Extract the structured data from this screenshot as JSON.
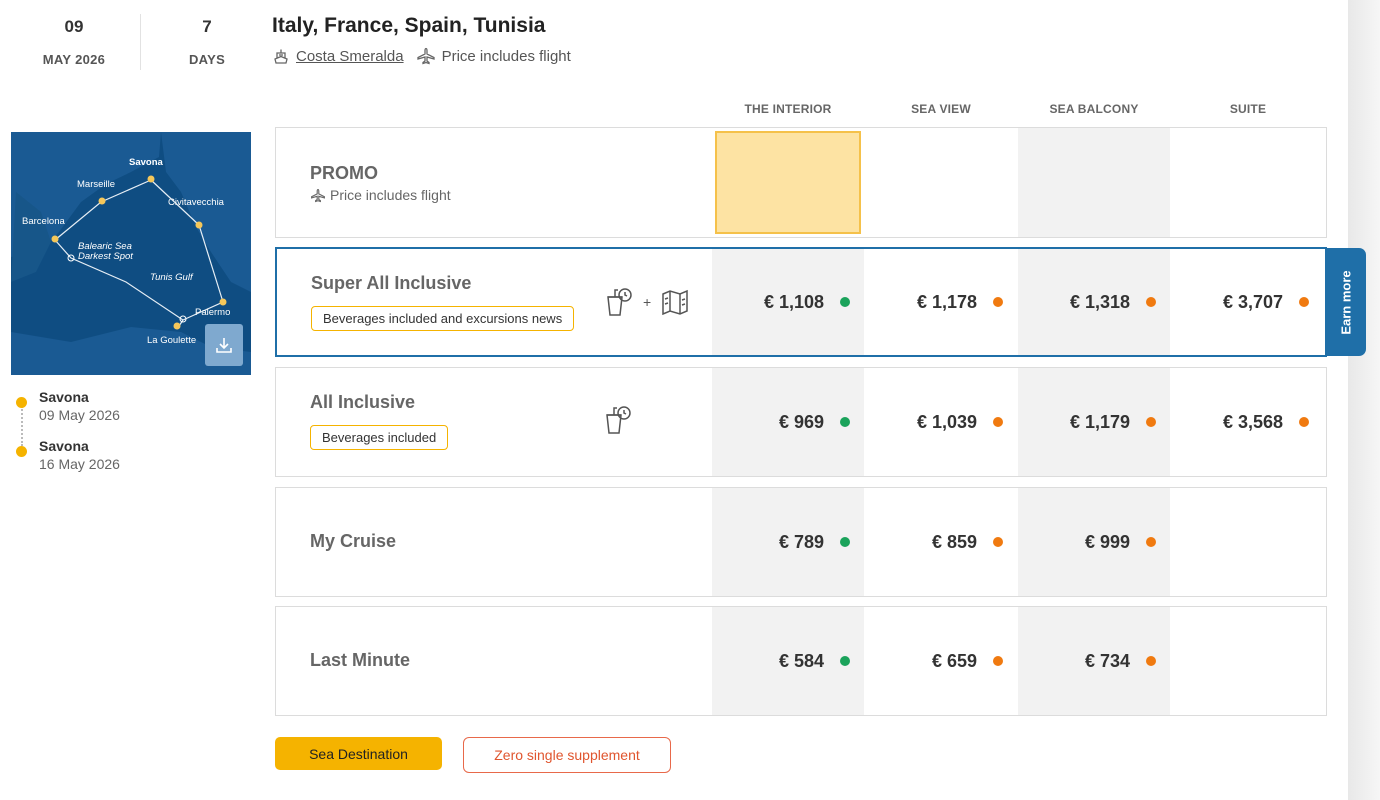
{
  "header": {
    "day": "09",
    "month_year": "MAY 2026",
    "duration": "7",
    "duration_unit": "DAYS",
    "title": "Italy, France, Spain, Tunisia",
    "ship_name": "Costa Smeralda",
    "flight_note": "Price includes flight"
  },
  "map": {
    "labels": {
      "savona": "Savona",
      "marseille": "Marseille",
      "civitavecchia": "Civitavecchia",
      "barcelona": "Barcelona",
      "balearic_1": "Balearic Sea",
      "balearic_2": "Darkest Spot",
      "tunis_gulf": "Tunis Gulf",
      "palermo": "Palermo",
      "la_goulette": "La Goulette"
    },
    "download_icon": "download-icon"
  },
  "itinerary": [
    {
      "port": "Savona",
      "date": "09 May 2026"
    },
    {
      "port": "Savona",
      "date": "16 May 2026"
    }
  ],
  "columns": [
    "THE INTERIOR",
    "SEA VIEW",
    "SEA BALCONY",
    "SUITE"
  ],
  "rows": {
    "promo": {
      "name": "PROMO",
      "sub": "Price includes flight"
    },
    "super": {
      "name": "Super All Inclusive",
      "tag": "Beverages included and excursions news",
      "plus": "+",
      "prices": [
        "€ 1,108",
        "€ 1,178",
        "€ 1,318",
        "€ 3,707"
      ],
      "availability": [
        "green",
        "orange",
        "orange",
        "orange"
      ]
    },
    "allinc": {
      "name": "All Inclusive",
      "tag": "Beverages included",
      "prices": [
        "€ 969",
        "€ 1,039",
        "€ 1,179",
        "€ 3,568"
      ],
      "availability": [
        "green",
        "orange",
        "orange",
        "orange"
      ]
    },
    "mycruise": {
      "name": "My Cruise",
      "prices": [
        "€ 789",
        "€ 859",
        "€ 999"
      ],
      "availability": [
        "green",
        "orange",
        "orange"
      ]
    },
    "lastmin": {
      "name": "Last Minute",
      "prices": [
        "€ 584",
        "€ 659",
        "€ 734"
      ],
      "availability": [
        "green",
        "orange",
        "orange"
      ]
    }
  },
  "earn_more": "Earn more",
  "badges": {
    "sea_destination": "Sea Destination",
    "zero_single": "Zero single supplement"
  },
  "colors": {
    "accent_yellow": "#f5b300",
    "accent_blue": "#1f6fa8",
    "available_green": "#1ba35b",
    "limited_orange": "#f07a10",
    "map_sea": "#0f4d82"
  }
}
